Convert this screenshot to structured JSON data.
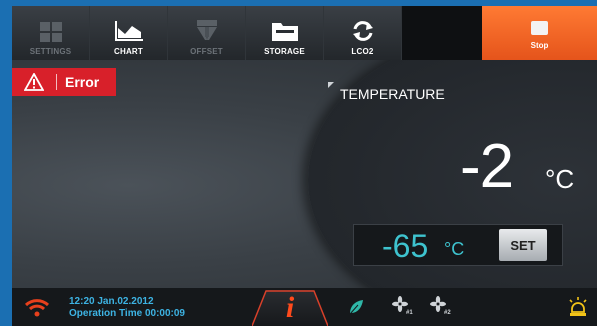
{
  "toolbar": {
    "settings_label": "SETTINGS",
    "chart_label": "CHART",
    "offset_label": "OFFSET",
    "storage_label": "STORAGE",
    "lco2_label": "LCO2",
    "stop_label": "Stop"
  },
  "error": {
    "label": "Error"
  },
  "temperature": {
    "label": "TEMPERATURE",
    "value": "-2",
    "unit": "°C"
  },
  "setpoint": {
    "value": "-65",
    "unit": "°C",
    "set_label": "SET"
  },
  "status": {
    "time": "12:20",
    "date": "Jan.02.2012",
    "operation_time": "Operation Time 00:00:09",
    "fan1_sub": "#1",
    "fan2_sub": "#2"
  },
  "colors": {
    "accent_orange": "#e5541b",
    "error_red": "#d8202a",
    "setpoint_cyan": "#3ec3cf",
    "status_blue": "#3db3e3",
    "info_red": "#ff4a1c",
    "background_blue": "#1b6fb2"
  },
  "icons": {
    "settings": "settings-grid-icon",
    "chart": "chart-icon",
    "offset": "offset-icon",
    "storage": "folder-icon",
    "lco2": "refresh-icon",
    "stop": "stop-icon",
    "error": "warning-triangle-icon",
    "wifi": "wifi-icon",
    "info": "info-icon",
    "leaf": "leaf-icon",
    "fan1": "fan-icon",
    "fan2": "fan-icon",
    "alarm": "alarm-light-icon"
  }
}
